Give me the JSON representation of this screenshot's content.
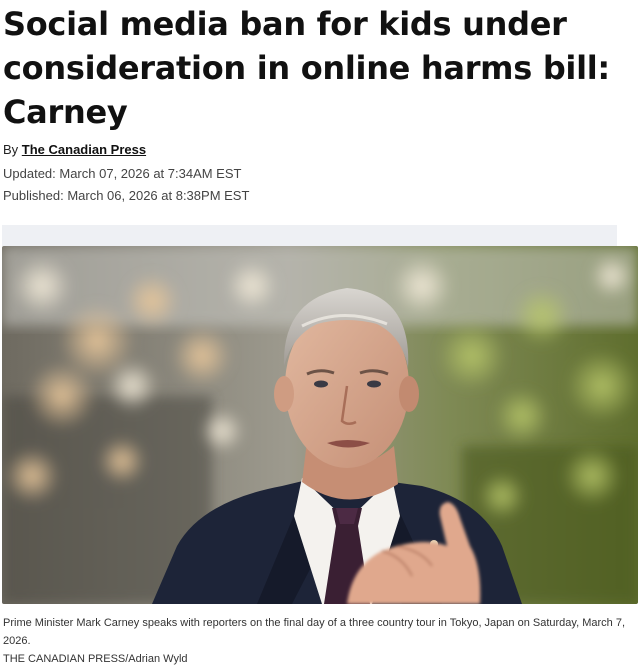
{
  "article": {
    "headline": "Social media ban for kids under consideration in online harms bill: Carney",
    "byline_prefix": "By",
    "byline_author": "The Canadian Press",
    "updated": "Updated: March 07, 2026 at 7:34AM EST",
    "published": "Published: March 06, 2026 at 8:38PM EST"
  },
  "photo": {
    "caption": "Prime Minister Mark Carney speaks with reporters on the final day of a three country tour in Tokyo, Japan on Saturday, March 7, 2026.",
    "credit": "THE CANADIAN PRESS/Adrian Wyld"
  },
  "colors": {
    "band": "#eef0f4",
    "suit": "#1d2438",
    "tie": "#3a1f33"
  }
}
